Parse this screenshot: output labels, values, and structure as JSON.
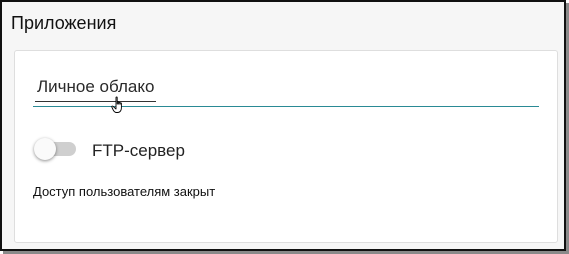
{
  "panel": {
    "title": "Приложения"
  },
  "tabs": [
    {
      "label": "Личное облако",
      "active": true
    }
  ],
  "ftp": {
    "toggle_label": "FTP-сервер",
    "enabled": false,
    "status_text": "Доступ пользователям закрыт"
  },
  "colors": {
    "accent": "#2a8a95",
    "toggle_track_off": "#cfcfcf",
    "toggle_knob": "#fafafa",
    "window_border": "#111111"
  },
  "icons": {
    "cursor": "hand-pointer-icon"
  }
}
